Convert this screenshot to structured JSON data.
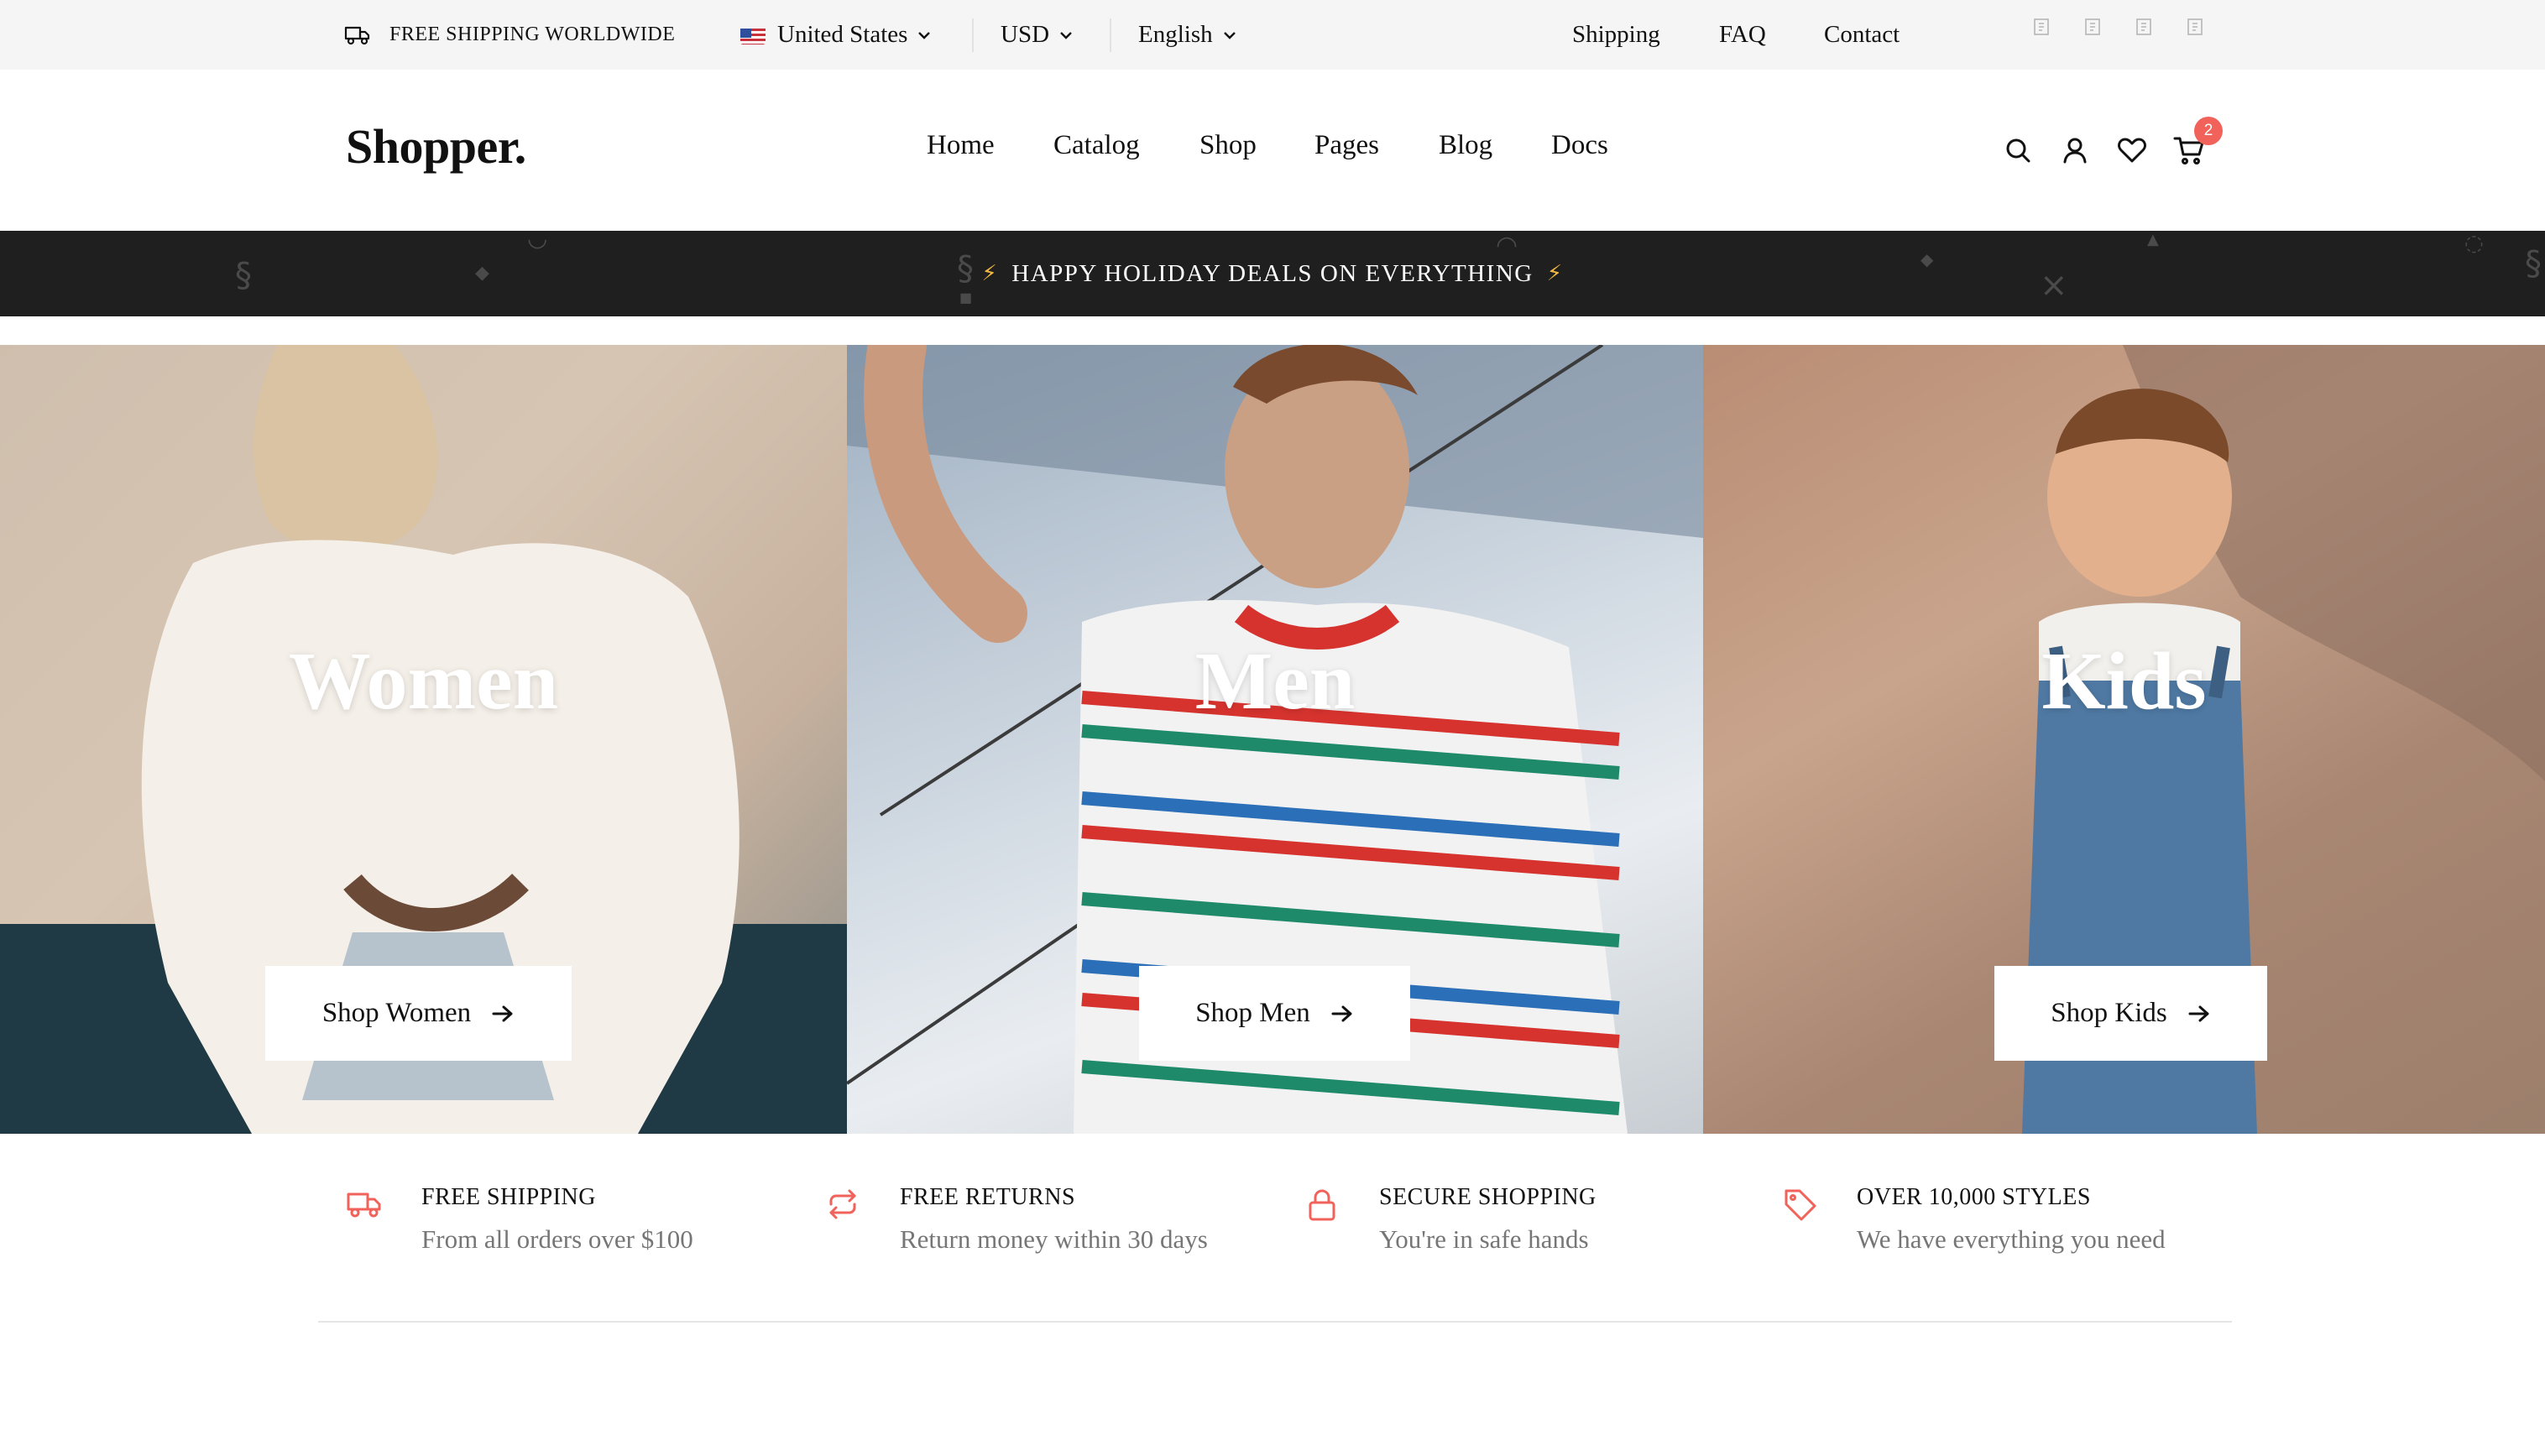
{
  "topbar": {
    "shipping_text": "FREE SHIPPING WORLDWIDE",
    "country": "United States",
    "currency": "USD",
    "language": "English",
    "links": {
      "shipping": "Shipping",
      "faq": "FAQ",
      "contact": "Contact"
    },
    "social_icons": [
      "facebook-icon",
      "twitter-icon",
      "instagram-icon",
      "medium-icon"
    ]
  },
  "header": {
    "logo": "Shopper.",
    "nav": {
      "home": "Home",
      "catalog": "Catalog",
      "shop": "Shop",
      "pages": "Pages",
      "blog": "Blog",
      "docs": "Docs"
    },
    "cart_count": "2",
    "icons": [
      "search-icon",
      "user-icon",
      "heart-icon",
      "cart-icon"
    ]
  },
  "promo": {
    "text": "HAPPY HOLIDAY DEALS ON EVERYTHING",
    "bolt": "⚡"
  },
  "categories": {
    "women": {
      "title": "Women",
      "button": "Shop Women"
    },
    "men": {
      "title": "Men",
      "button": "Shop Men"
    },
    "kids": {
      "title": "Kids",
      "button": "Shop Kids"
    }
  },
  "features": {
    "shipping": {
      "title": "FREE SHIPPING",
      "subtitle": "From all orders over $100"
    },
    "returns": {
      "title": "FREE RETURNS",
      "subtitle": "Return money within 30 days"
    },
    "secure": {
      "title": "SECURE SHOPPING",
      "subtitle": "You're in safe hands"
    },
    "styles": {
      "title": "OVER 10,000 STYLES",
      "subtitle": "We have everything you need"
    }
  },
  "colors": {
    "accent": "#f0625a",
    "topbar_bg": "#f5f5f5",
    "promo_bg": "#1f1f1f",
    "muted_text": "#767676"
  }
}
